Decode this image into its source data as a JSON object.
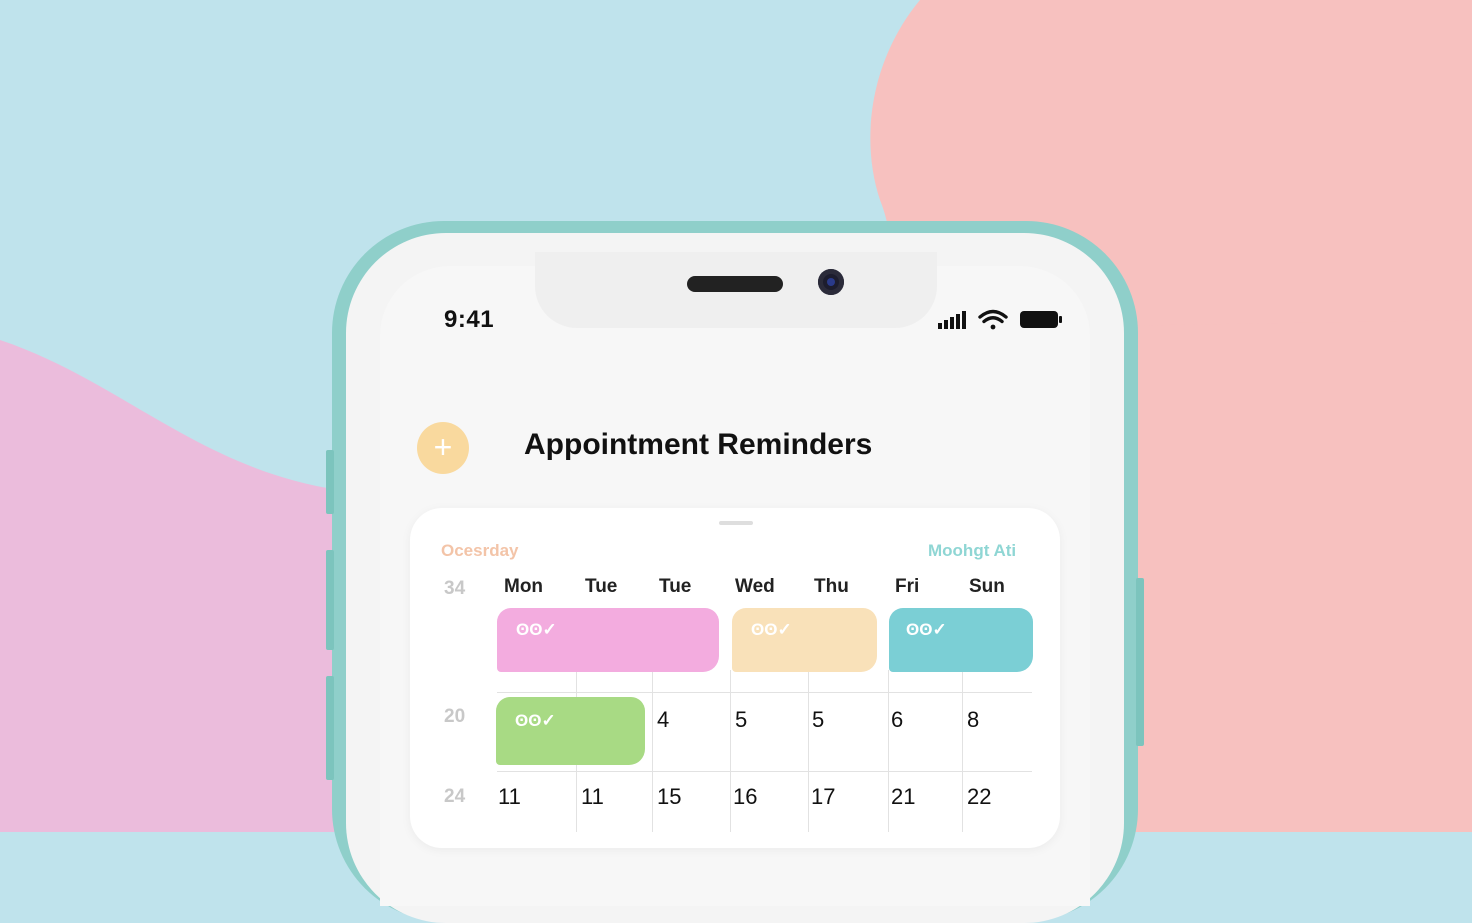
{
  "colors": {
    "bg_blue": "#bfe3ec",
    "bg_pink": "#f7c1bf",
    "bg_lilac": "#ebbcdc",
    "frame": "#8fcfca",
    "add_button": "#f9d99e",
    "event_pink": "#f3acdf",
    "event_peach": "#f9e1b9",
    "event_teal": "#7bcfd5",
    "event_green": "#a8da84"
  },
  "status_bar": {
    "time": "9:41"
  },
  "header": {
    "add_label": "+",
    "title": "Appointment Reminders"
  },
  "calendar": {
    "left_label": "Ocesrday",
    "right_label": "Moohgt Ati",
    "days": [
      "Mon",
      "Tue",
      "Tue",
      "Wed",
      "Thu",
      "Fri",
      "Sun"
    ],
    "weeks": [
      {
        "number": "34",
        "dates": []
      },
      {
        "number": "20",
        "dates": [
          "4",
          "5",
          "5",
          "6",
          "8"
        ]
      },
      {
        "number": "24",
        "dates": [
          "11",
          "11",
          "15",
          "16",
          "17",
          "21",
          "22"
        ]
      }
    ],
    "events": [
      {
        "color": "pink",
        "icon": "apple-check-icon"
      },
      {
        "color": "peach",
        "icon": "apple-check-icon"
      },
      {
        "color": "teal",
        "icon": "apple-check-icon"
      },
      {
        "color": "green",
        "icon": "apple-check-icon"
      }
    ]
  }
}
